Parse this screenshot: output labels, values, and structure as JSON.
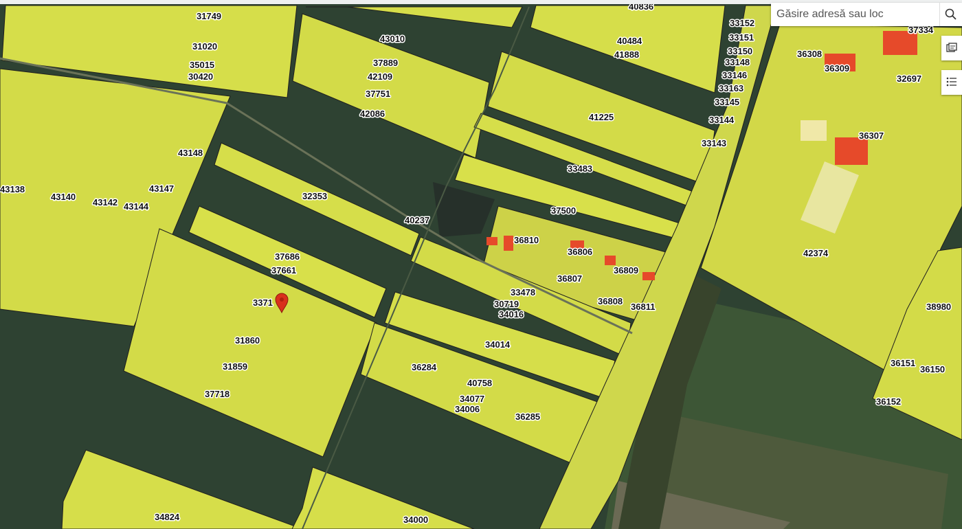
{
  "search": {
    "placeholder": "Găsire adresă sau loc"
  },
  "icons": {
    "search": "search-icon",
    "basemap": "basemap-gallery-icon",
    "legend": "legend-list-icon",
    "location_pin": "map-pin-icon"
  },
  "colors": {
    "parcel_fill": "#d8e04a",
    "parcel_outline": "#1e1e1e",
    "field_dark": "#2e4232",
    "field_green": "#3f5a3b",
    "road": "#cfd74c",
    "building": "#e64a2a",
    "pin": "#d9301c"
  },
  "parcels": [
    {
      "id": "p0",
      "label": "31749"
    },
    {
      "id": "p1",
      "label": "31020"
    },
    {
      "id": "p2",
      "label": "35015"
    },
    {
      "id": "p3",
      "label": "30420"
    },
    {
      "id": "p4",
      "label": "43010"
    },
    {
      "id": "p5",
      "label": "37889"
    },
    {
      "id": "p6",
      "label": "42109"
    },
    {
      "id": "p7",
      "label": "37751"
    },
    {
      "id": "p8",
      "label": "42086"
    },
    {
      "id": "p9",
      "label": "40836"
    },
    {
      "id": "p10",
      "label": "40484"
    },
    {
      "id": "p11",
      "label": "41888"
    },
    {
      "id": "p12",
      "label": "33152"
    },
    {
      "id": "p13",
      "label": "33151"
    },
    {
      "id": "p14",
      "label": "33150"
    },
    {
      "id": "p15",
      "label": "33148"
    },
    {
      "id": "p16",
      "label": "33146"
    },
    {
      "id": "p17",
      "label": "33163"
    },
    {
      "id": "p18",
      "label": "33145"
    },
    {
      "id": "p19",
      "label": "33144"
    },
    {
      "id": "p20",
      "label": "33143"
    },
    {
      "id": "p21",
      "label": "41225"
    },
    {
      "id": "p22",
      "label": "33483"
    },
    {
      "id": "p23",
      "label": "37500"
    },
    {
      "id": "p24",
      "label": "43148"
    },
    {
      "id": "p25",
      "label": "43138"
    },
    {
      "id": "p26",
      "label": "43140"
    },
    {
      "id": "p27",
      "label": "43142"
    },
    {
      "id": "p28",
      "label": "43144"
    },
    {
      "id": "p29",
      "label": "43147"
    },
    {
      "id": "p30",
      "label": "32353"
    },
    {
      "id": "p31",
      "label": "40237"
    },
    {
      "id": "p32",
      "label": "36810"
    },
    {
      "id": "p33",
      "label": "36806"
    },
    {
      "id": "p34",
      "label": "36809"
    },
    {
      "id": "p35",
      "label": "36807"
    },
    {
      "id": "p36",
      "label": "36808"
    },
    {
      "id": "p37",
      "label": "36811"
    },
    {
      "id": "p38",
      "label": "37686"
    },
    {
      "id": "p39",
      "label": "37661"
    },
    {
      "id": "p40",
      "label": "3371"
    },
    {
      "id": "p41",
      "label": "33478"
    },
    {
      "id": "p42",
      "label": "30719"
    },
    {
      "id": "p43",
      "label": "34016"
    },
    {
      "id": "p44",
      "label": "31860"
    },
    {
      "id": "p45",
      "label": "34014"
    },
    {
      "id": "p46",
      "label": "31859"
    },
    {
      "id": "p47",
      "label": "36284"
    },
    {
      "id": "p48",
      "label": "40758"
    },
    {
      "id": "p49",
      "label": "37718"
    },
    {
      "id": "p50",
      "label": "34077"
    },
    {
      "id": "p51",
      "label": "34006"
    },
    {
      "id": "p52",
      "label": "36285"
    },
    {
      "id": "p53",
      "label": "34824"
    },
    {
      "id": "p54",
      "label": "34000"
    },
    {
      "id": "p55",
      "label": "37334"
    },
    {
      "id": "p56",
      "label": "36308"
    },
    {
      "id": "p57",
      "label": "36309"
    },
    {
      "id": "p58",
      "label": "32697"
    },
    {
      "id": "p59",
      "label": "36307"
    },
    {
      "id": "p60",
      "label": "42374"
    },
    {
      "id": "p61",
      "label": "38980"
    },
    {
      "id": "p62",
      "label": "36151"
    },
    {
      "id": "p63",
      "label": "36150"
    },
    {
      "id": "p64",
      "label": "36152"
    }
  ]
}
